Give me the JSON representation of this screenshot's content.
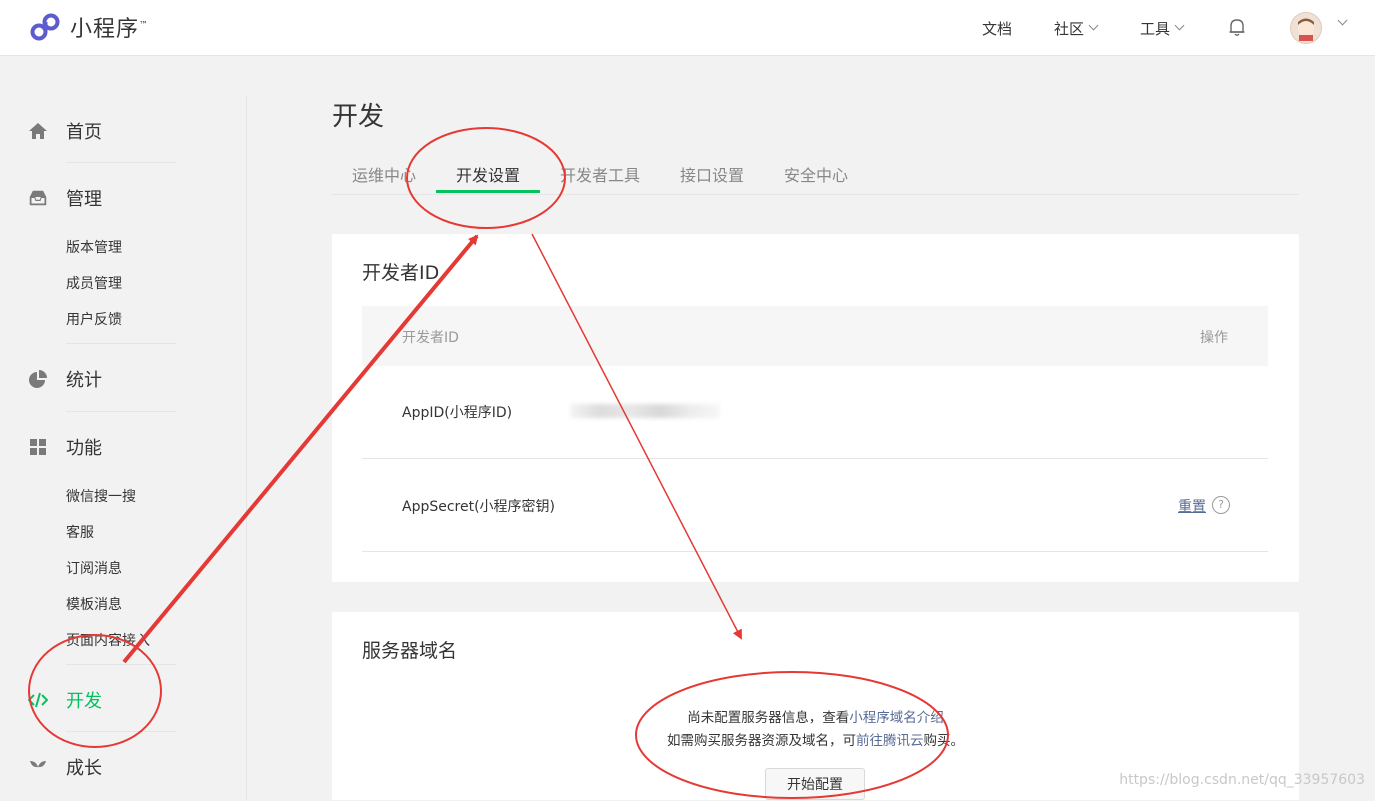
{
  "brand": {
    "name": "小程序",
    "tm": "™",
    "accent": "#07c160",
    "logo_color": "#5c5ccd"
  },
  "topnav": {
    "docs": "文档",
    "community": "社区",
    "tools": "工具"
  },
  "sidebar": {
    "home": "首页",
    "manage": {
      "label": "管理",
      "items": [
        "版本管理",
        "成员管理",
        "用户反馈"
      ]
    },
    "stats": "统计",
    "features": {
      "label": "功能",
      "items": [
        "微信搜一搜",
        "客服",
        "订阅消息",
        "模板消息",
        "页面内容接入"
      ]
    },
    "develop": "开发",
    "growth": "成长"
  },
  "main": {
    "title": "开发",
    "tabs": [
      "运维中心",
      "开发设置",
      "开发者工具",
      "接口设置",
      "安全中心"
    ],
    "active_tab": "开发设置",
    "dev_id_card": {
      "title": "开发者ID",
      "col_id": "开发者ID",
      "col_action": "操作",
      "appid_label": "AppID(小程序ID)",
      "appsecret_label": "AppSecret(小程序密钥)",
      "reset_link": "重置",
      "help": "?"
    },
    "server_card": {
      "title": "服务器域名",
      "msg1_prefix": "尚未配置服务器信息，查看",
      "msg1_link": "小程序域名介绍",
      "msg2_prefix": "如需购买服务器资源及域名，可",
      "msg2_link": "前往腾讯云",
      "msg2_suffix": "购买。",
      "start_button": "开始配置"
    }
  },
  "watermark": "https://blog.csdn.net/qq_33957603",
  "annotation_color": "#e53935"
}
